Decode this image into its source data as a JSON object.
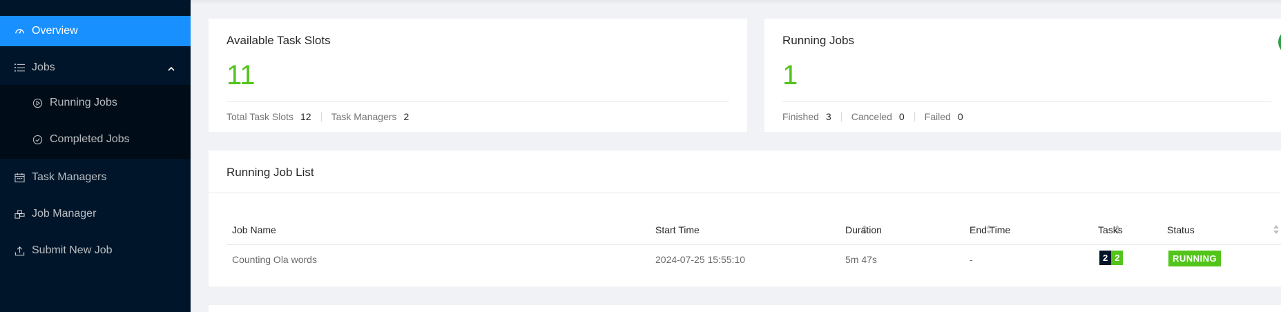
{
  "sidebar": {
    "items": [
      {
        "label": "Overview",
        "icon": "dashboard-icon",
        "active": true
      },
      {
        "label": "Jobs",
        "icon": "list-icon"
      },
      {
        "label": "Running Jobs",
        "icon": "play-circle-icon"
      },
      {
        "label": "Completed Jobs",
        "icon": "check-circle-icon"
      },
      {
        "label": "Task Managers",
        "icon": "schedule-icon"
      },
      {
        "label": "Job Manager",
        "icon": "build-icon"
      },
      {
        "label": "Submit New Job",
        "icon": "upload-icon"
      }
    ]
  },
  "slots_card": {
    "title": "Available Task Slots",
    "value": "11",
    "total_label": "Total Task Slots",
    "total_value": "12",
    "tm_label": "Task Managers",
    "tm_value": "2"
  },
  "jobs_card": {
    "title": "Running Jobs",
    "value": "1",
    "finished_label": "Finished",
    "finished_value": "3",
    "canceled_label": "Canceled",
    "canceled_value": "0",
    "failed_label": "Failed",
    "failed_value": "0"
  },
  "job_list": {
    "title": "Running Job List",
    "columns": [
      "Job Name",
      "Start Time",
      "Duration",
      "End Time",
      "Tasks",
      "Status"
    ],
    "rows": [
      {
        "name": "Counting Ola words",
        "start": "2024-07-25 15:55:10",
        "duration": "5m 47s",
        "end": "-",
        "tasks_total": "2",
        "tasks_running": "2",
        "status": "RUNNING"
      }
    ]
  },
  "colors": {
    "sidebar_bg": "#001529",
    "active": "#1890ff",
    "success": "#52c41a"
  }
}
